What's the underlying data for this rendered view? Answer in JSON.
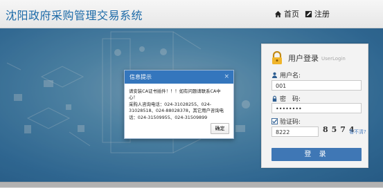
{
  "header": {
    "site_title": "沈阳政府采购管理交易系统",
    "nav_home": "首页",
    "nav_register": "注册"
  },
  "login": {
    "title": "用户登录",
    "subtitle": "UserLogin",
    "username_label": "用户名:",
    "username_value": "001",
    "password_label": "密　码:",
    "password_value": "••••••••",
    "captcha_label": "验证码:",
    "captcha_value": "8222",
    "captcha_image_text": "8574",
    "captcha_refresh": "看不清?",
    "submit_label": "登 录"
  },
  "dialog": {
    "title": "信息提示",
    "close": "×",
    "line1": "请安装CA证书插件！！！如有问题请联系CA中心！",
    "line2": "采购人咨询电话：024-31028255、024-31028518、024-88028378，其它用户咨询电话：024-31509955、024-31509899",
    "ok_label": "确定"
  },
  "colors": {
    "title_blue": "#1c6aa8",
    "dialog_header": "#3476bd",
    "login_button": "#3f77b5"
  }
}
